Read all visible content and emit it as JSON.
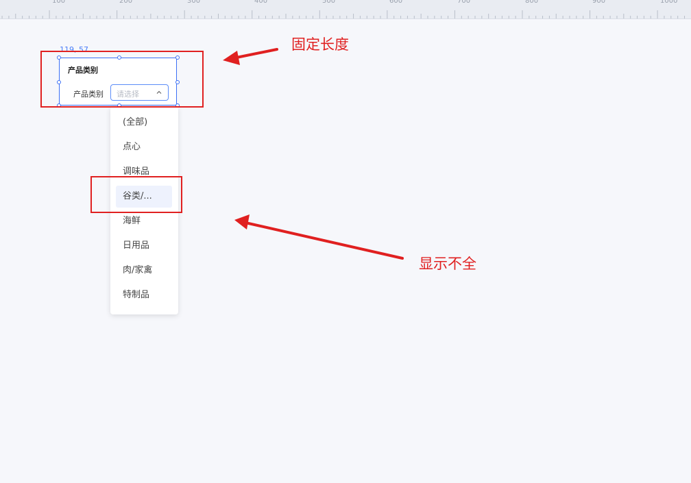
{
  "ruler": {
    "labels": [
      "100",
      "200",
      "300",
      "400",
      "500",
      "600",
      "700",
      "800",
      "900",
      "1000"
    ]
  },
  "coordinates": "119, 57",
  "widget": {
    "title": "产品类别",
    "field_label": "产品类别",
    "placeholder": "请选择"
  },
  "dropdown": {
    "options": [
      "(全部)",
      "点心",
      "调味品",
      "谷类/...",
      "海鲜",
      "日用品",
      "肉/家禽",
      "特制品"
    ],
    "hovered_index": 3
  },
  "annotations": {
    "fixed_length": "固定长度",
    "incomplete_display": "显示不全",
    "color": "#e02020"
  },
  "colors": {
    "accent": "#3b6ff5",
    "annotation": "#e02020"
  }
}
